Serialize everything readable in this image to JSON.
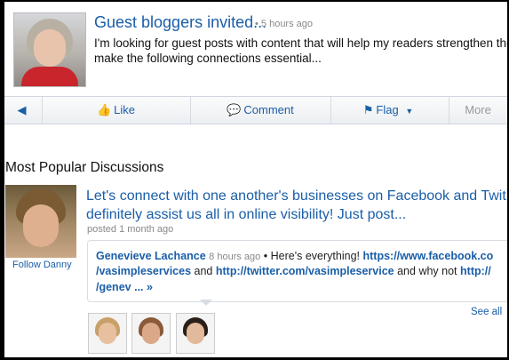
{
  "post": {
    "title": "Guest bloggers invited...",
    "time": "• 5 hours ago",
    "body_line1": "I'm looking for guest posts with content that will help my readers strengthen their",
    "body_line2": "make the following connections essential..."
  },
  "actions": {
    "like": "Like",
    "comment": "Comment",
    "flag": "Flag",
    "more": "More"
  },
  "section": {
    "title": "Most Popular Discussions"
  },
  "discussion": {
    "author_follow": "Follow Danny",
    "title_line1": "Let's connect with one another's businesses on Facebook and Twit",
    "title_line2": "definitely assist us all in online visibility! Just post...",
    "meta": "posted 1 month ago",
    "latest": {
      "author": "Genevieve Lachance",
      "time": "8 hours ago",
      "bullet": "•",
      "text1": "Here's everything!",
      "link1": "https://www.facebook.co",
      "line2_link": "/vasimpleservices",
      "line2_and": "and",
      "line2_link2": "http://twitter.com/vasimpleservice",
      "line2_text": "and why not",
      "line2_link3": "http://",
      "line3_link": "/genev",
      "line3_more": "... »"
    },
    "see_all": "See all"
  }
}
